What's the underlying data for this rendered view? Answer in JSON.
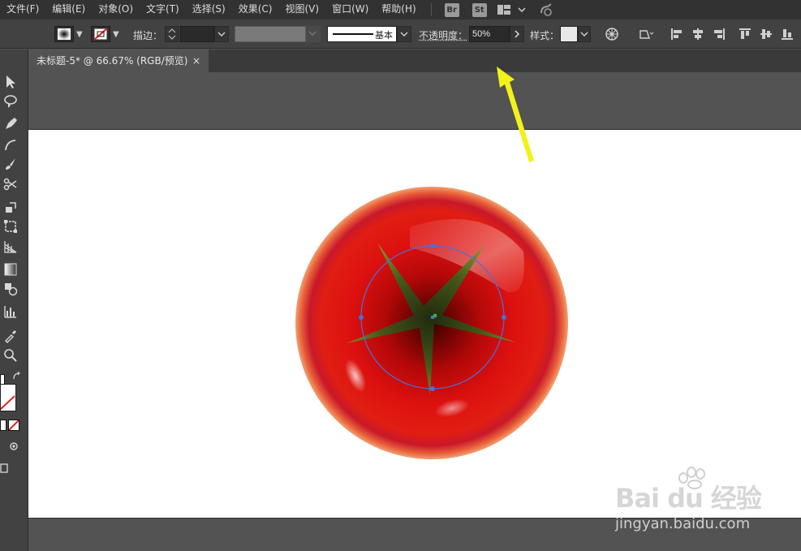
{
  "menu": {
    "items": [
      {
        "label": "文件(F)"
      },
      {
        "label": "编辑(E)"
      },
      {
        "label": "对象(O)"
      },
      {
        "label": "文字(T)"
      },
      {
        "label": "选择(S)"
      },
      {
        "label": "效果(C)"
      },
      {
        "label": "视图(V)"
      },
      {
        "label": "窗口(W)"
      },
      {
        "label": "帮助(H)"
      }
    ],
    "bridge_badge": "Br",
    "stock_badge": "St"
  },
  "controlbar": {
    "stroke_label": "描边：",
    "brush_label": "基本",
    "opacity_label": "不透明度：",
    "opacity_value": "50%",
    "style_label": "样式："
  },
  "document": {
    "tab_title": "未标题-5* @ 66.67% (RGB/预览)",
    "close_glyph": "×"
  },
  "colors": {
    "menubar": "#323232",
    "controlbar": "#424242",
    "canvas": "#ffffff",
    "tomato": "#e01010",
    "stem": "#4f6a1e",
    "selection": "#4a70d8",
    "arrow": "#f2f21a"
  },
  "watermark": {
    "logo": "Bai du 经验",
    "url": "jingyan.baidu.com"
  }
}
